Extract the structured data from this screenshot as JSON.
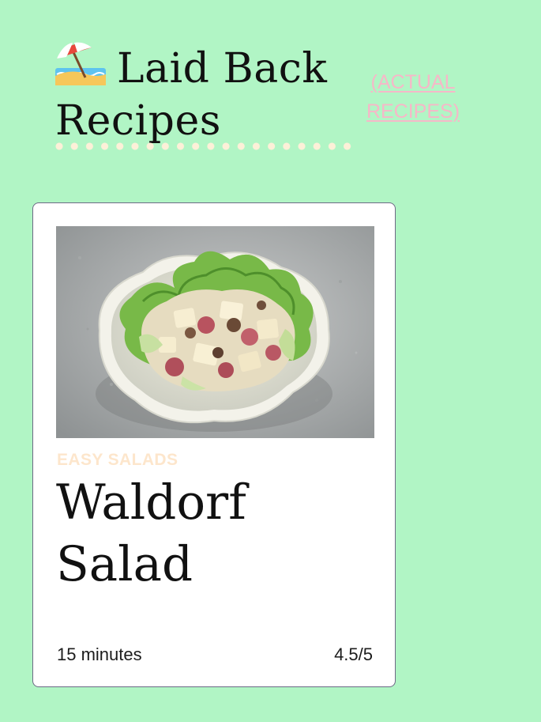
{
  "header": {
    "title": "Laid Back Recipes",
    "title_icon": "beach-umbrella-icon",
    "actual_link": "(ACTUAL RECIPES)"
  },
  "colors": {
    "background": "#b1f5c5",
    "link": "#f6b8c8",
    "category": "#fde6cc",
    "divider_dots": "#fdf0d8",
    "card_border": "#6e6a86"
  },
  "recipe_card": {
    "category": "EASY SALADS",
    "title": "Waldorf Salad",
    "time": "15 minutes",
    "rating": "4.5/5",
    "image_icon": "salad-photo"
  }
}
